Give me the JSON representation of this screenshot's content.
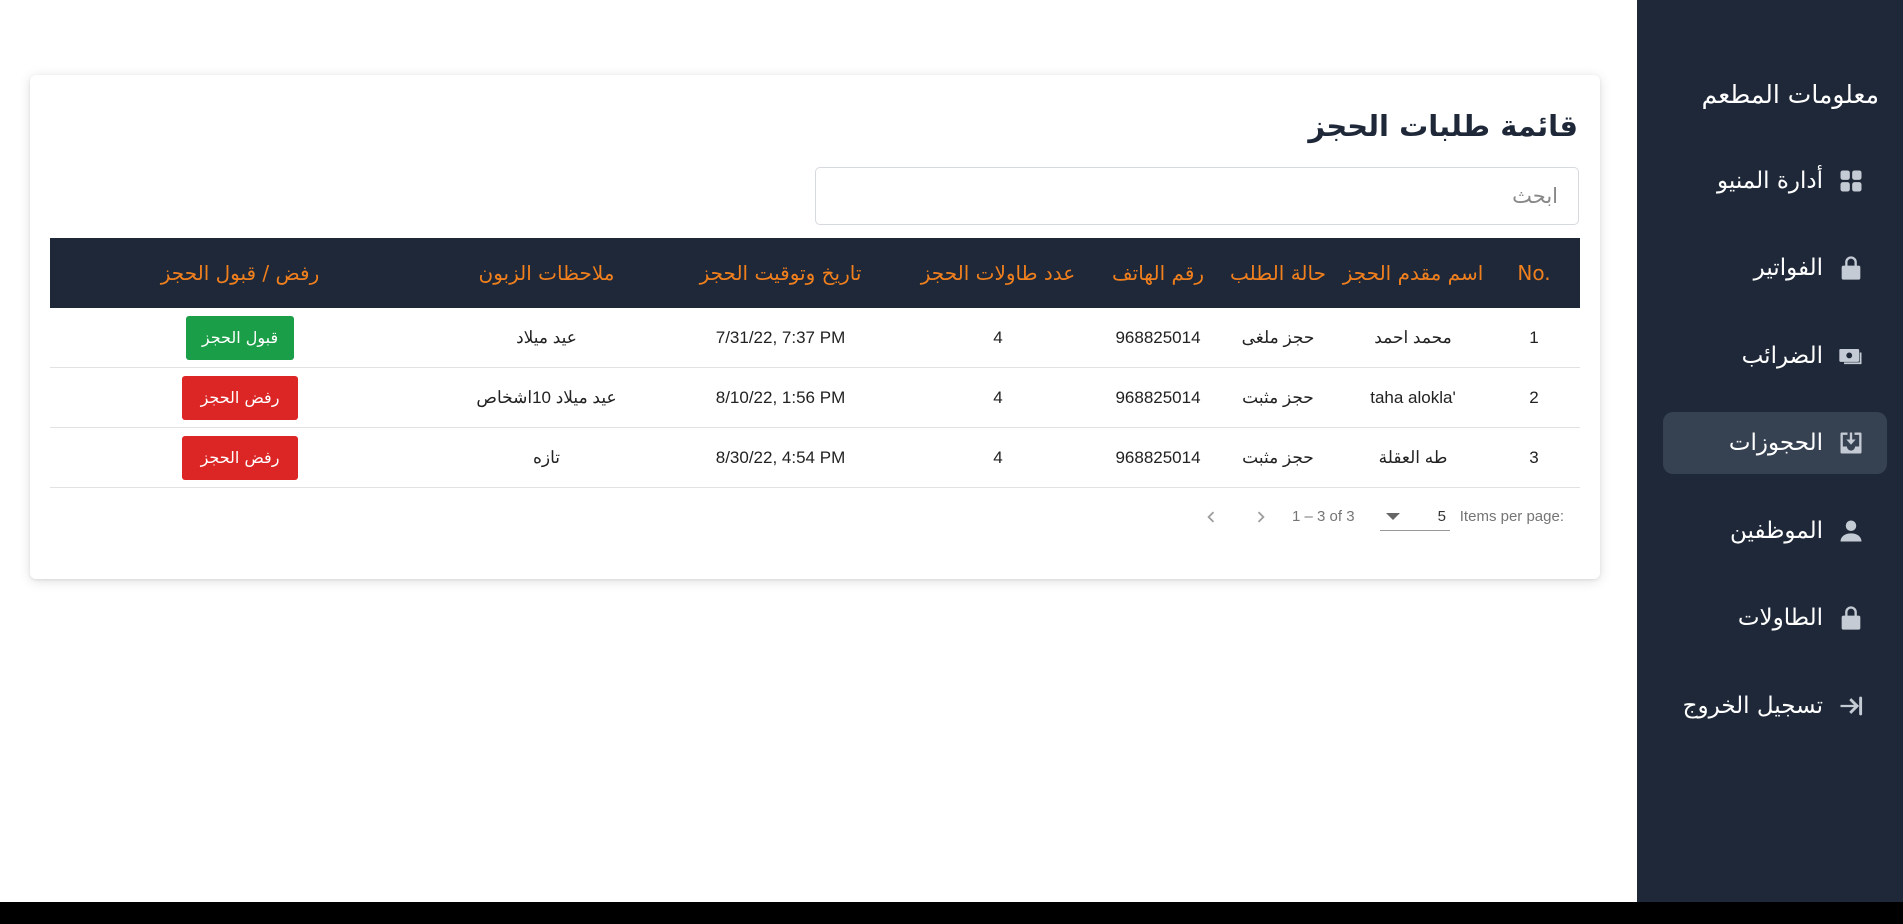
{
  "sidebar": {
    "brand": "معلومات المطعم",
    "items": [
      {
        "label": "أدارة المنيو",
        "icon": "grid-icon",
        "active": false
      },
      {
        "label": "الفواتير",
        "icon": "lock-icon",
        "active": false
      },
      {
        "label": "الضرائب",
        "icon": "cash-icon",
        "active": false
      },
      {
        "label": "الحجوزات",
        "icon": "inbox-download-icon",
        "active": true
      },
      {
        "label": "الموظفين",
        "icon": "person-icon",
        "active": false
      },
      {
        "label": "الطاولات",
        "icon": "lock-icon",
        "active": false
      },
      {
        "label": "تسجيل الخروج",
        "icon": "logout-icon",
        "active": false
      }
    ]
  },
  "main": {
    "title": "قائمة طلبات الحجز",
    "search": {
      "placeholder": "ابحث",
      "value": ""
    },
    "table": {
      "headers": [
        "No.",
        "اسم مقدم الحجز",
        "حالة الطلب",
        "رقم الهاتف",
        "عدد طاولات الحجز",
        "تاريخ وتوقيت الحجز",
        "ملاحظات الزبون",
        "رفض / قبول الحجز"
      ],
      "rows": [
        {
          "no": "1",
          "name": "محمد احمد",
          "status": "حجز ملغى",
          "status_color": "#e02424",
          "phone": "968825014",
          "tables": "4",
          "datetime": "7/31/22, 7:37 PM",
          "notes": "عيد ميلاد",
          "action": "قبول الحجز",
          "action_color": "#1a9e47"
        },
        {
          "no": "2",
          "name": "taha alokla'",
          "status": "حجز مثبت",
          "status_color": "#1a8fc9",
          "phone": "968825014",
          "tables": "4",
          "datetime": "8/10/22, 1:56 PM",
          "notes": "عيد ميلاد 10اشخاص",
          "action": "رفض الحجز",
          "action_color": "#dc2626"
        },
        {
          "no": "3",
          "name": "طه العقلة",
          "status": "حجز مثبت",
          "status_color": "#1a8fc9",
          "phone": "968825014",
          "tables": "4",
          "datetime": "8/30/22, 4:54 PM",
          "notes": "تازه",
          "action": "رفض الحجز",
          "action_color": "#dc2626"
        }
      ]
    },
    "paginator": {
      "items_per_page_label": "Items per page:",
      "page_size": "5",
      "range": "1 – 3 of 3",
      "prev_icon": "chevron-left-icon",
      "next_icon": "chevron-right-icon"
    }
  }
}
